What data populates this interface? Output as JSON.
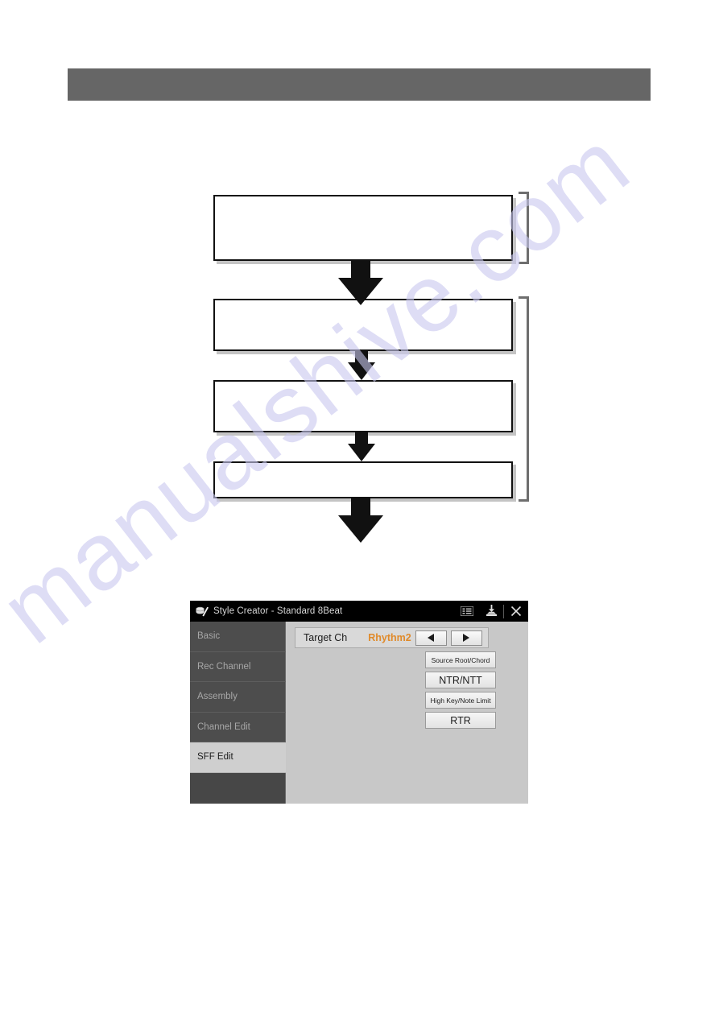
{
  "page": {
    "watermark": "manualshive.com"
  },
  "header": {
    "band_color": "#666666"
  },
  "flowchart": {
    "boxes": [
      {
        "id": "box1",
        "label": ""
      },
      {
        "id": "box2",
        "label": ""
      },
      {
        "id": "box3",
        "label": ""
      },
      {
        "id": "box4",
        "label": ""
      }
    ],
    "brackets": 2,
    "arrows": 4
  },
  "dialog": {
    "titlebar": {
      "app_icon": "drum-pencil-icon",
      "title": "Style Creator - Standard 8Beat",
      "menu_icon": "list-menu-icon",
      "save_icon": "save-icon",
      "close_icon": "close-icon"
    },
    "sidebar": {
      "items": [
        {
          "label": "Basic",
          "selected": false
        },
        {
          "label": "Rec Channel",
          "selected": false
        },
        {
          "label": "Assembly",
          "selected": false
        },
        {
          "label": "Channel Edit",
          "selected": false
        },
        {
          "label": "SFF Edit",
          "selected": true
        },
        {
          "label": "",
          "selected": false
        }
      ]
    },
    "content": {
      "target_ch": {
        "label": "Target Ch",
        "value": "Rhythm2",
        "value_color": "#e08a2a",
        "prev_icon": "triangle-left-icon",
        "next_icon": "triangle-right-icon"
      },
      "buttons": [
        {
          "label": "Source Root/Chord",
          "size": "small"
        },
        {
          "label": "NTR/NTT",
          "size": "large"
        },
        {
          "label": "High Key/Note Limit",
          "size": "small"
        },
        {
          "label": "RTR",
          "size": "large"
        }
      ]
    }
  }
}
